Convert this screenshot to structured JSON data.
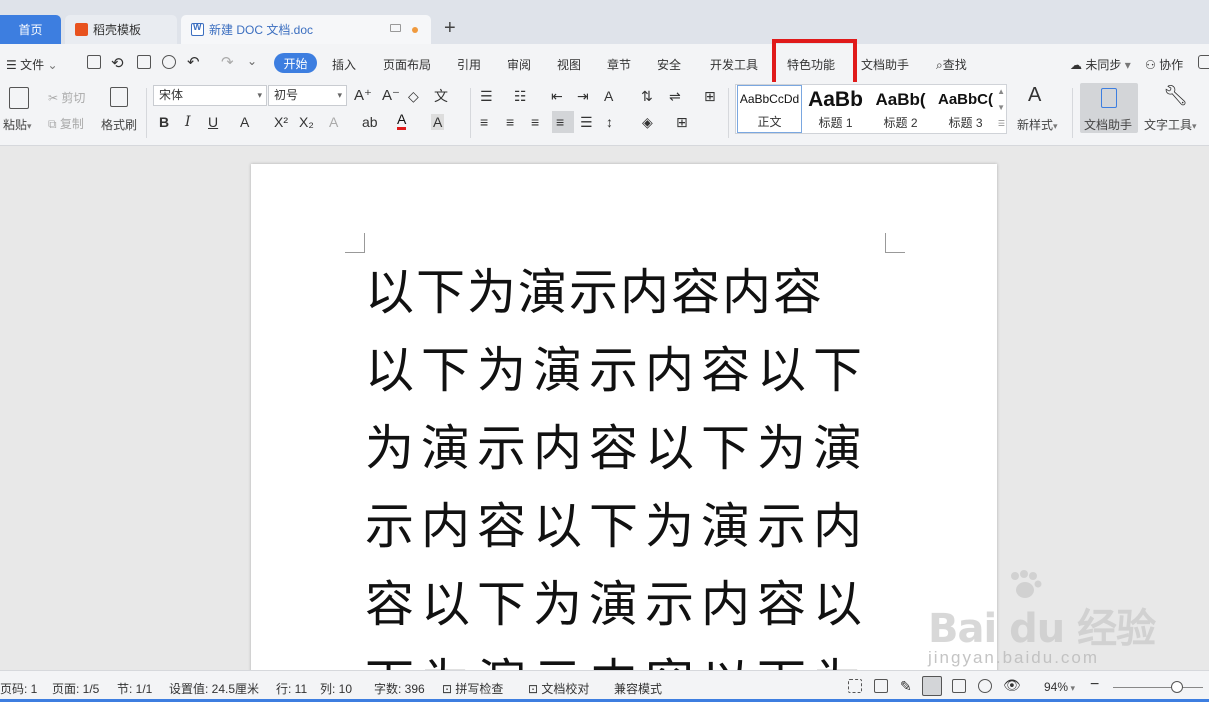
{
  "tabs": {
    "home": "首页",
    "template": "稻壳模板",
    "document": "新建 DOC 文档.doc"
  },
  "menu": {
    "file": "文件",
    "start": "开始",
    "insert": "插入",
    "layout": "页面布局",
    "reference": "引用",
    "review": "审阅",
    "view": "视图",
    "chapter": "章节",
    "security": "安全",
    "developer": "开发工具",
    "special": "特色功能",
    "doc_assist": "文档助手",
    "find": "查找",
    "sync": "未同步",
    "collab": "协作"
  },
  "ribbon": {
    "paste": "粘贴",
    "cut": "剪切",
    "copy": "复制",
    "format_painter": "格式刷",
    "font_name": "宋体",
    "font_size": "初号",
    "styles": [
      {
        "preview": "AaBbCcDd",
        "label": "正文"
      },
      {
        "preview": "AaBb",
        "label": "标题 1"
      },
      {
        "preview": "AaBb(",
        "label": "标题 2"
      },
      {
        "preview": "AaBbC(",
        "label": "标题 3"
      }
    ],
    "new_style": "新样式",
    "doc_assistant": "文档助手",
    "text_tools": "文字工具"
  },
  "document": {
    "lines": [
      "以下为演示内容内容",
      "以下为演示内容以下",
      "为演示内容以下为演",
      "示内容以下为演示内",
      "容以下为演示内容以",
      "下为演示内容以下为"
    ]
  },
  "watermark": {
    "brand": "Bai du 经验",
    "url": "jingyan.baidu.com"
  },
  "status": {
    "page": "页码: 1",
    "pages": "页面: 1/5",
    "section": "节: 1/1",
    "setting": "设置值: 24.5厘米",
    "row": "行: 11",
    "col": "列: 10",
    "words": "字数: 396",
    "spell": "拼写检查",
    "proof": "文档校对",
    "compat": "兼容模式",
    "zoom": "94%"
  },
  "colors": {
    "accent": "#3d7ee0",
    "highlight": "#e01a1a"
  }
}
